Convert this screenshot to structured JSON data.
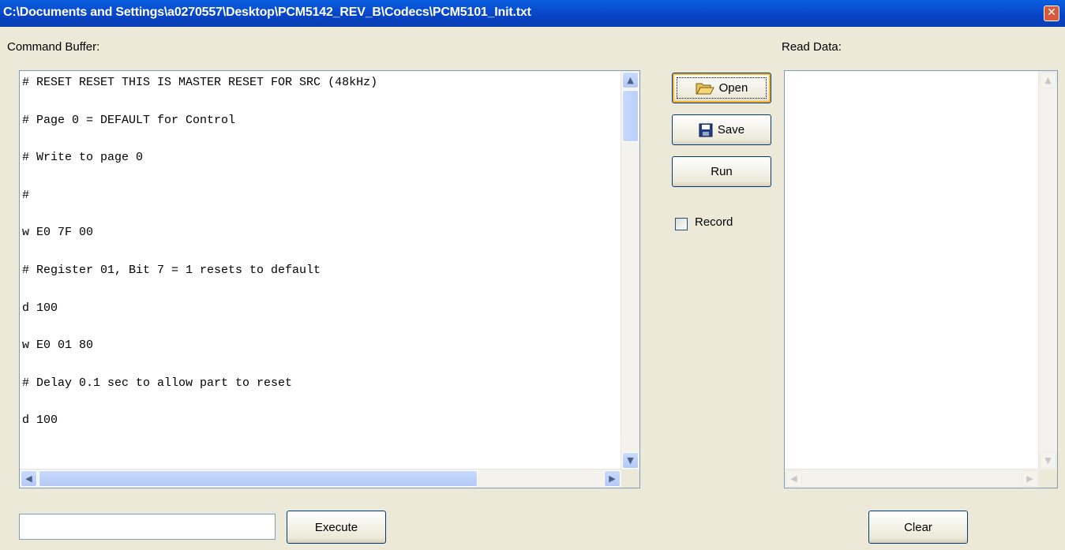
{
  "window": {
    "title": "C:\\Documents and Settings\\a0270557\\Desktop\\PCM5142_REV_B\\Codecs\\PCM5101_Init.txt",
    "close_glyph": "✕"
  },
  "command_buffer": {
    "label": "Command Buffer:",
    "lines": [
      "# RESET RESET THIS IS MASTER RESET FOR SRC (48kHz)",
      "# Page 0 = DEFAULT for Control",
      "# Write to page 0",
      "#",
      "w E0 7F 00",
      "# Register 01, Bit 7 = 1 resets to default",
      "d 100",
      "w E0 01 80",
      "# Delay 0.1 sec to allow part to reset",
      "d 100"
    ]
  },
  "read_data": {
    "label": "Read Data:"
  },
  "buttons": {
    "open": "Open",
    "save": "Save",
    "run": "Run",
    "execute": "Execute",
    "clear": "Clear"
  },
  "record": {
    "label": "Record",
    "checked": false
  },
  "execute_input": {
    "value": ""
  },
  "icons": {
    "open": "folder-open-icon",
    "save": "floppy-disk-icon",
    "scroll_up": "▲",
    "scroll_down": "▼",
    "scroll_left": "◀",
    "scroll_right": "▶"
  },
  "colors": {
    "titlebar": "#0743c4",
    "window_bg": "#ece9d8",
    "panel_border": "#7f9db9"
  }
}
